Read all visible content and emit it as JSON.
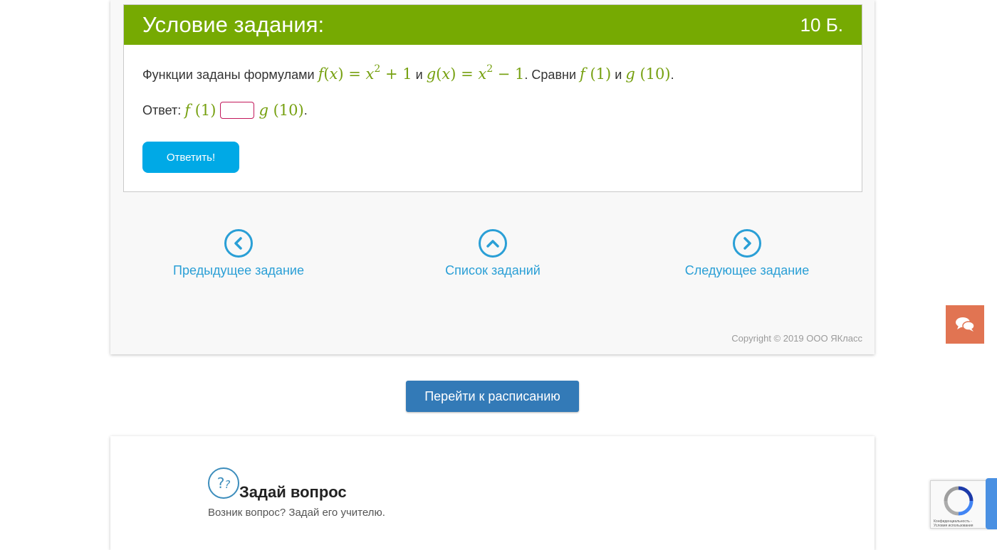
{
  "task": {
    "title": "Условие задания:",
    "points": "10 Б.",
    "text_prefix": "Функции заданы формулами",
    "text_and": "и",
    "text_compare": ". Сравни",
    "text_and2": "и",
    "text_end": ".",
    "answer_label": "Ответ:",
    "answer_end": ".",
    "answer_value": "",
    "submit_label": "Ответить!"
  },
  "navigation": {
    "prev_label": "Предыдущее задание",
    "list_label": "Список заданий",
    "next_label": "Следующее задание"
  },
  "copyright": "Copyright © 2019 ООО ЯКласс",
  "schedule_button": "Перейти к расписанию",
  "question": {
    "title": "Задай вопрос",
    "subtitle": "Возник вопрос? Задай его учителю."
  },
  "recaptcha": {
    "text": "Конфиденциальность - Условия использования"
  },
  "colors": {
    "header_green": "#76aa02",
    "submit_blue": "#00a9e6",
    "nav_blue": "#2a9fd6",
    "schedule_blue": "#337ab7",
    "feedback_orange": "#e17452",
    "input_border": "#c2185b"
  },
  "icons": {
    "prev": "chevron-left-icon",
    "list": "chevron-up-icon",
    "next": "chevron-right-icon",
    "feedback": "chat-bubbles-icon",
    "question": "question-marks-icon",
    "recaptcha": "recaptcha-logo-icon"
  }
}
